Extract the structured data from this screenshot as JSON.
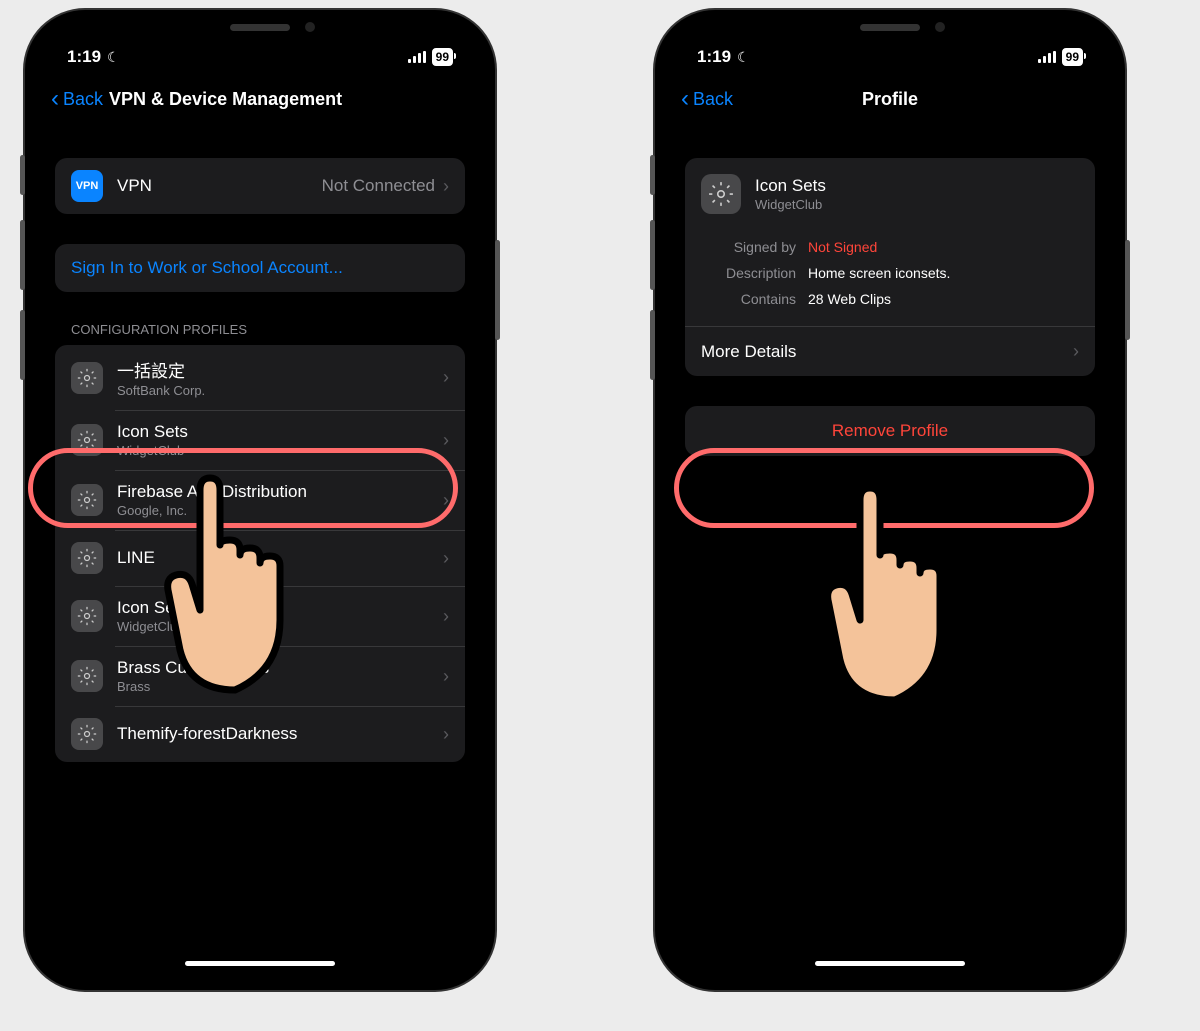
{
  "status": {
    "time": "1:19",
    "battery": "99"
  },
  "phone1": {
    "nav": {
      "back": "Back",
      "title": "VPN & Device Management"
    },
    "vpn": {
      "label": "VPN",
      "status": "Not Connected"
    },
    "signin": {
      "label": "Sign In to Work or School Account..."
    },
    "section_header": "CONFIGURATION PROFILES",
    "profiles": [
      {
        "title": "一括設定",
        "subtitle": "SoftBank Corp."
      },
      {
        "title": "Icon Sets",
        "subtitle": "WidgetClub"
      },
      {
        "title": "Firebase App Distribution",
        "subtitle": "Google, Inc."
      },
      {
        "title": "LINE"
      },
      {
        "title": "Icon Sets",
        "subtitle": "WidgetClub"
      },
      {
        "title": "Brass Custom Icons",
        "subtitle": "Brass"
      },
      {
        "title": "Themify-forestDarkness"
      }
    ]
  },
  "phone2": {
    "nav": {
      "back": "Back",
      "title": "Profile"
    },
    "profile": {
      "title": "Icon Sets",
      "subtitle": "WidgetClub",
      "signed_by_label": "Signed by",
      "signed_by_value": "Not Signed",
      "description_label": "Description",
      "description_value": "Home screen iconsets.",
      "contains_label": "Contains",
      "contains_value": "28 Web Clips",
      "more_details": "More Details"
    },
    "remove": "Remove Profile"
  }
}
